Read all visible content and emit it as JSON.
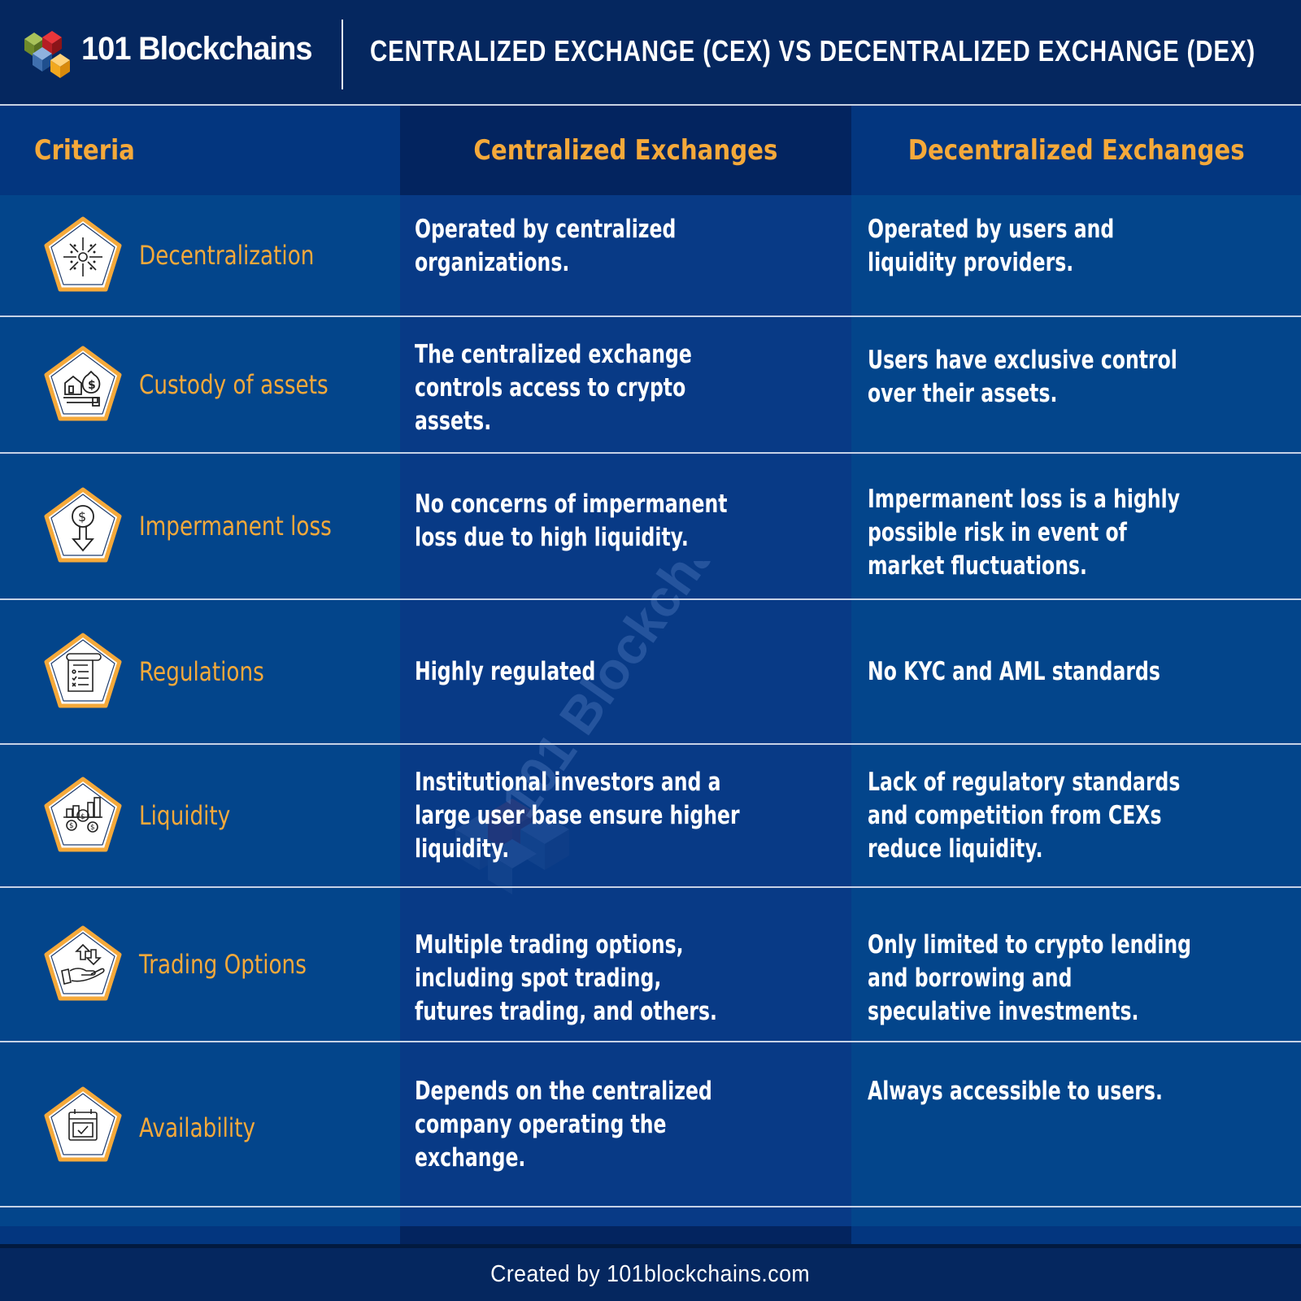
{
  "header": {
    "brand": "101 Blockchains",
    "title": "CENTRALIZED EXCHANGE (CEX) VS DECENTRALIZED EXCHANGE (DEX)",
    "logo_icon": "cube-cluster-logo-icon"
  },
  "table": {
    "columns": [
      "Criteria",
      "Centralized Exchanges",
      "Decentralized Exchanges"
    ],
    "rows": [
      {
        "criteria": "Decentralization",
        "icon": "network-nodes-icon",
        "cex": "Operated by centralized organizations.",
        "dex": "Operated by users and liquidity providers."
      },
      {
        "criteria": "Custody of assets",
        "icon": "hand-holding-assets-icon",
        "cex": "The centralized exchange controls access to crypto assets.",
        "dex": "Users have exclusive control over their assets."
      },
      {
        "criteria": "Impermanent loss",
        "icon": "dollar-down-arrow-icon",
        "cex": "No concerns of impermanent loss due to high liquidity.",
        "dex": "Impermanent loss is a highly possible risk in event of market fluctuations."
      },
      {
        "criteria": "Regulations",
        "icon": "checklist-scroll-icon",
        "cex": "Highly regulated",
        "dex": "No KYC and AML standards"
      },
      {
        "criteria": "Liquidity",
        "icon": "coins-bar-chart-icon",
        "cex": "Institutional investors and a large user base ensure higher liquidity.",
        "dex": "Lack of regulatory standards and competition from CEXs reduce liquidity."
      },
      {
        "criteria": "Trading Options",
        "icon": "hand-exchange-arrows-icon",
        "cex": "Multiple trading options, including spot trading, futures trading, and others.",
        "dex": "Only limited to crypto lending and borrowing and speculative investments."
      },
      {
        "criteria": "Availability",
        "icon": "calendar-check-icon",
        "cex": "Depends on the centralized company operating the exchange.",
        "dex": "Always accessible to users."
      }
    ]
  },
  "watermark": "101 Blockchains",
  "footer": {
    "credit": "Created by 101blockchains.com"
  },
  "colors": {
    "accent_orange": "#f5a93a",
    "navy_dark": "#05275f",
    "blue_mid": "#03458b",
    "blue_center": "#083a86"
  }
}
